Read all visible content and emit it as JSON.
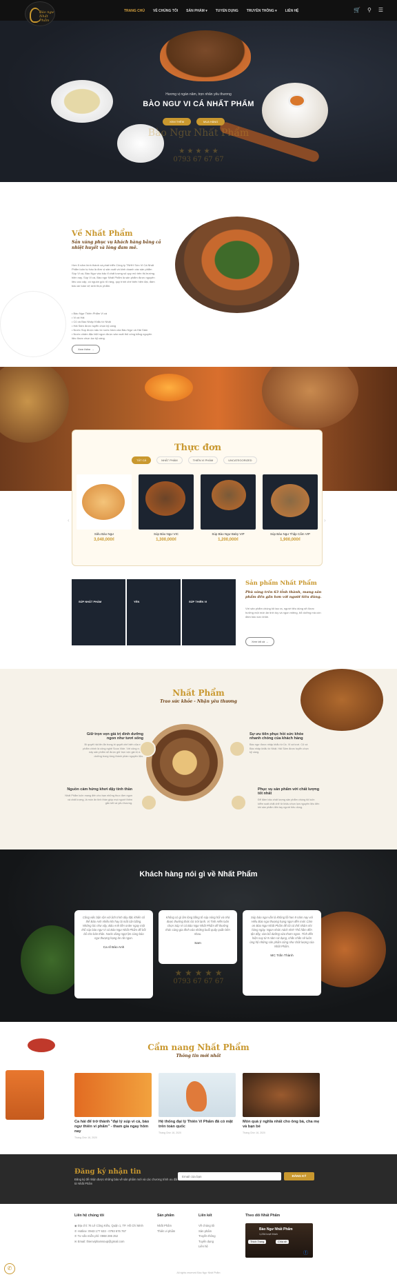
{
  "nav": {
    "items": [
      "TRANG CHỦ",
      "VỀ CHÚNG TÔI",
      "SẢN PHẨM",
      "TUYỂN DỤNG",
      "TRUYỀN THÔNG",
      "LIÊN HỆ"
    ],
    "logo_text": "Bào ngư Nhất Phẩm"
  },
  "hero": {
    "subtitle": "Hương vị ngàn năm, trọn nhân yêu thương",
    "title": "BÀO NGƯ VI CÁ NHẤT PHẨM",
    "btn1": "XEM THÊM",
    "btn2": "MUA HÀNG",
    "watermark": "Bào Ngư Nhất Phẩm",
    "phone": "0793 67 67 67"
  },
  "about": {
    "title": "Về Nhất Phẩm",
    "subtitle": "Sản xúng phục vụ khách hàng bằng cả nhiệt huyết và lòng đam mê.",
    "body": "Hơn 5 năm hình thành và phát triển Công ty TNHH Sức Vi Cá Nhất Phẩm luôn tự hào là đơn vị sản xuất và kinh doanh các sản phẩm Súp Vi cá, Bào Ngư vào bậc tỉ chất lượng số quy mô trên thị trường hiện nay. Súp Vi cá, Bào ngư Nhất Phẩm là sản phẩm được nguyên liệu cao cấp, có nguồn gốc rõ ràng, quy trình chế biến hiện đại, đảm bảo an toàn vệ sinh thực phẩm.",
    "list": [
      "• Bào Ngư Thiên Phẩm Vi cá",
      "• Vi cá Hải",
      "• Củ và Bào Nhập Khẩu từ Nhật",
      "• Hải Sâm được tuyển chọn kỹ càng",
      "• Nước Súp được nấu từ nước hầm của Bào Ngư và Hải Sâm",
      "• Nước chấm đặc biệt ngon được sản xuất thủ công bằng nguyên liệu được chọn lọc kỹ càng."
    ],
    "button": "Xem thêm"
  },
  "menu": {
    "title": "Thực đơn",
    "tabs": [
      "TẤT CẢ",
      "NHẤT PHẨM",
      "THIÊN VI PHẨM",
      "UNCATEGORIZED"
    ],
    "products": [
      {
        "name": "Siêu Bào Ngư",
        "price": "3,040,000₫"
      },
      {
        "name": "Súp Bào Ngư VIC",
        "price": "1,300,000₫"
      },
      {
        "name": "Súp Bào Ngư Baby VIP",
        "price": "1,200,000₫"
      },
      {
        "name": "Súp Bào Ngư Thập Cẩm VIP",
        "price": "1,900,000₫"
      }
    ]
  },
  "products_section": {
    "tiles": [
      "SÚP NHẤT PHẨM",
      "YẾN",
      "SÚP THIÊN VI"
    ],
    "title": "Sản phẩm Nhất Phẩm",
    "subtitle": "Phù sóng trên 63 tỉnh thành, mang sản phẩm đến gần hơn với người tiêu dùng.",
    "body": "Với sản phẩm chúng tôi tạo ra, người tiêu dùng sẽ được hưởng một món ăn tinh túy và ngon miệng, bổ dưỡng mà còn đảm bảo sức khỏe.",
    "button": "Xem tất cả"
  },
  "nhatpham": {
    "title": "Nhất Phẩm",
    "subtitle": "Trao sức khỏe - Nhận yêu thương",
    "f1_title": "Giữ trọn vẹn giá trị dinh dưỡng ngon như tươi sống",
    "f1_text": "Bí quyết hải lên ẩn trong bí quyết chế biến của sản phẩm chính là công nghệ Sous Vide. Với công nghệ này sản phẩm sẽ được giữ trọn vẹn giá trị dinh dưỡng trong từng thành phần nguyên liệu.",
    "f2_title": "Nguồn cảm hứng khơi dậy tinh thần",
    "f2_text": "Nhất Phẩm luôn mang đến cho bạn những thực đơn ngon và chất lượng, là món ăn tinh thần giúp mọi người thêm gắn kết và yêu thương.",
    "f3_title": "Sự ưu tiên phục hồi sức khỏe nhanh chóng của khách hàng",
    "f3_text": "Bào ngư được nhập khẩu từ Úc. Vi cá tươi. Củ và Bào nhập khẩu từ Nhật. Hải Sâm được tuyển chọn kỹ càng.",
    "f4_title": "Phục vụ sản phẩm với chất lượng tốt nhất",
    "f4_text": "Để đảm bảo chất lượng sản phẩm chúng tôi luôn kiểm soát chặt chẽ từ khâu chọn lựa nguyên liệu đến khi sản phẩm đến tay người tiêu dùng."
  },
  "testimonials": {
    "title": "Khách hàng nói gì về Nhất Phẩm",
    "items": [
      {
        "text": "Công việc bận rộn với lịch trình dày đặc khiến cô thể Bảo Anh nhiều khi hay bị mất cân bằng. Những lúc như vậy, Bảo Anh liền order ngay một thố súp bào ngư Vi cá Bào Ngư Nhất Phẩm để bồi bổ cho bản thân. Nước dùng ngọt lịm cùng bào ngư thượng hạng ăn rất ngon.",
        "who": "Ca sĩ Bảo Anh"
      },
      {
        "text": "Không có gì ấm lòng bằng tô súp nóng hổi và nhà được thưởng thức lúc trời lạnh. Vị Tinh Hiền luôn chọn Súp Vi cá Bào Ngư Nhất Phẩm để thưởng thức cùng gia đình vào những buổi quây quần bên nhau.",
        "who": "Sam"
      },
      {
        "text": "Súp bào ngư vẫn là không lỗi hẹn 9 năm nay với Hiếu Bào ngư thượng hạng ngon đến mức Cảm ơn Bào Ngư Nhất Phẩm để tôi có thể nhâm nhi hàng ngày. Ngon nhức nách nhé! Thố hầm đến tận đây, vừa bổ dưỡng vừa thơm ngon. Tính đến hiện nay từ 9 năm sử dụng, chắc chắn sẽ luôn ủng hộ những sản phẩm cũng như chất lượng của Nhất Phẩm.",
        "who": "MC Trấn Thành"
      }
    ]
  },
  "blog": {
    "title": "Cẩm nang Nhất Phẩm",
    "subtitle": "Thông tin mới nhất",
    "posts": [
      {
        "title": "Ca hải để trở thành \"đại lý súp vi cá, bào ngư thiên vi phẩm\" - tham gia ngay hôm nay",
        "date": "Tháng Chín 16, 2020"
      },
      {
        "title": "Hệ thống đại lý Thiên Vi Phẩm đã có mặt trên toàn quốc",
        "date": "Tháng Chín 16, 2020"
      },
      {
        "title": "Món quà ý nghĩa nhất cho ông bà, cha mẹ và bạn bè",
        "date": "Tháng Chín 16, 2020"
      }
    ]
  },
  "newsletter": {
    "title": "Đăng ký nhận tin",
    "text": "Đăng ký để nhận được những bảo về sản phẩm mới và các chương trình ưu đãi từ Nhất Phẩm",
    "placeholder": "Email của bạn",
    "button": "ĐĂNG KÝ"
  },
  "footer": {
    "c1": "Liên hệ chúng tôi",
    "address": "Địa chỉ: 76 Lê Công Kiều, Quận 1, TP. Hồ Chí Minh",
    "hotline": "Hotline: 0943 177 633 - 0793 676 767",
    "tuvan": "Tư vấn miễn phí: 0968 286 252",
    "email": "Email: thienviphamsoup@gmail.com",
    "c2": "Sản phẩm",
    "c2_items": [
      "Nhất Phẩm",
      "Thiên vi phẩm"
    ],
    "c3": "Liên kết",
    "c3_items": [
      "Về chúng tôi",
      "Sản phẩm",
      "Truyền thông",
      "Tuyển dụng",
      "Liên hệ"
    ],
    "c4": "Theo dõi Nhất Phẩm",
    "fb_name": "Bào Ngư Nhất Phẩm",
    "fb_likes": "1,234 lượt thích",
    "fb_like": "Thích Trang",
    "fb_share": "Chia sẻ",
    "copyright": "All rights reserved Bào Ngư Nhất Phẩm"
  }
}
